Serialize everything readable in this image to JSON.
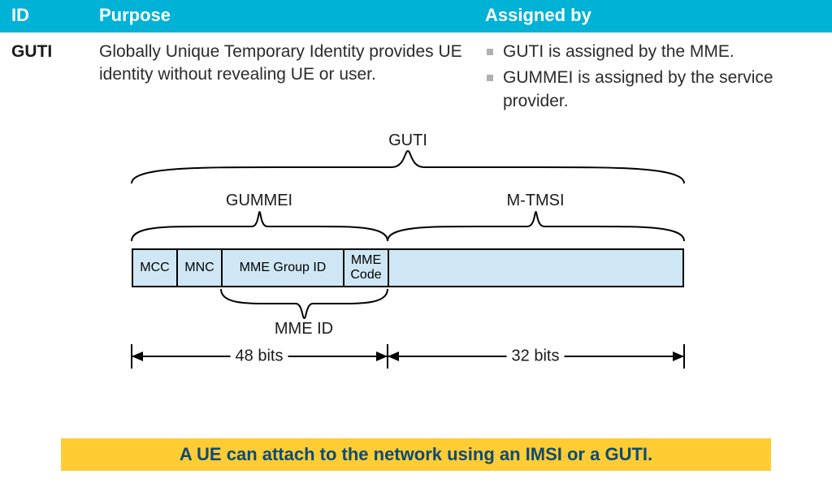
{
  "table": {
    "headers": {
      "id": "ID",
      "purpose": "Purpose",
      "assigned": "Assigned by"
    },
    "row": {
      "id": "GUTI",
      "purpose": "Globally Unique Temporary Identity provides UE identity without revealing UE or user.",
      "assigned": [
        "GUTI is assigned by the MME.",
        "GUMMEI is assigned by the service provider."
      ]
    }
  },
  "diagram": {
    "top_brace_label": "GUTI",
    "gummei_label": "GUMMEI",
    "mtmsi_label": "M-TMSI",
    "mmeid_label": "MME ID",
    "fields": {
      "mcc": "MCC",
      "mnc": "MNC",
      "mme_group_id": "MME Group ID",
      "mme_code": "MME\nCode"
    },
    "dim_left": "48 bits",
    "dim_right": "32 bits"
  },
  "banner": "A UE can attach to the network using an IMSI or a GUTI.",
  "chart_data": {
    "type": "table",
    "title": "GUTI structure",
    "fields_order": [
      "MCC",
      "MNC",
      "MME Group ID",
      "MME Code",
      "M-TMSI"
    ],
    "groupings": {
      "GUTI": [
        "MCC",
        "MNC",
        "MME Group ID",
        "MME Code",
        "M-TMSI"
      ],
      "GUMMEI": [
        "MCC",
        "MNC",
        "MME Group ID",
        "MME Code"
      ],
      "MME ID": [
        "MME Group ID",
        "MME Code"
      ],
      "M-TMSI": [
        "M-TMSI"
      ]
    },
    "bit_widths": {
      "GUMMEI_total_bits": 48,
      "M-TMSI_bits": 32
    }
  }
}
